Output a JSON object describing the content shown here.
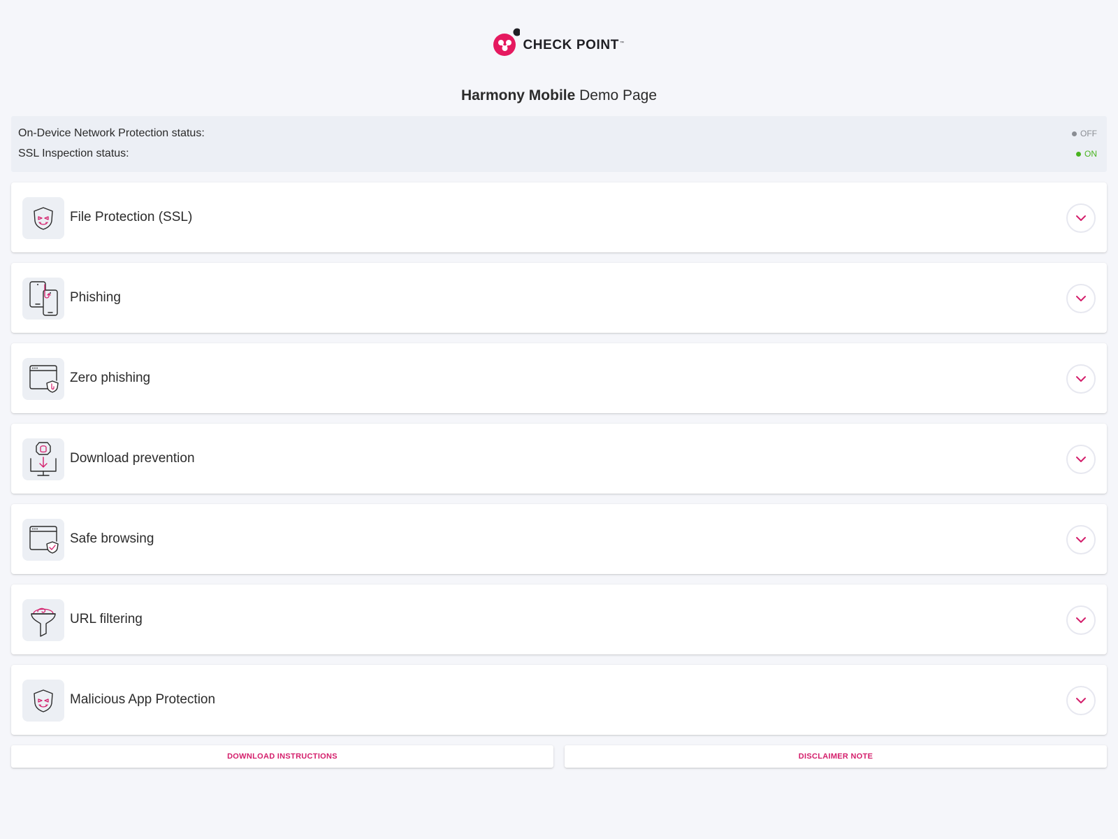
{
  "logo": {
    "text": "CHECK POINT",
    "trademark": "™"
  },
  "title": {
    "bold": "Harmony Mobile",
    "rest": "Demo Page"
  },
  "status": {
    "network": {
      "label": "On-Device Network Protection status:",
      "value": "OFF"
    },
    "ssl": {
      "label": "SSL Inspection status:",
      "value": "ON"
    }
  },
  "colors": {
    "accent": "#d41e6b",
    "on": "#49b31f",
    "off": "#8a8d93"
  },
  "features": [
    {
      "label": "File Protection (SSL)",
      "icon": "malware-shield-icon"
    },
    {
      "label": "Phishing",
      "icon": "phishing-phones-icon"
    },
    {
      "label": "Zero phishing",
      "icon": "browser-phishing-icon"
    },
    {
      "label": "Download prevention",
      "icon": "download-prevention-icon"
    },
    {
      "label": "Safe browsing",
      "icon": "browser-shield-icon"
    },
    {
      "label": "URL filtering",
      "icon": "url-filter-icon"
    },
    {
      "label": "Malicious App Protection",
      "icon": "malware-shield-icon"
    }
  ],
  "buttons": {
    "download_instructions": "DOWNLOAD INSTRUCTIONS",
    "disclaimer_note": "DISCLAIMER NOTE"
  }
}
